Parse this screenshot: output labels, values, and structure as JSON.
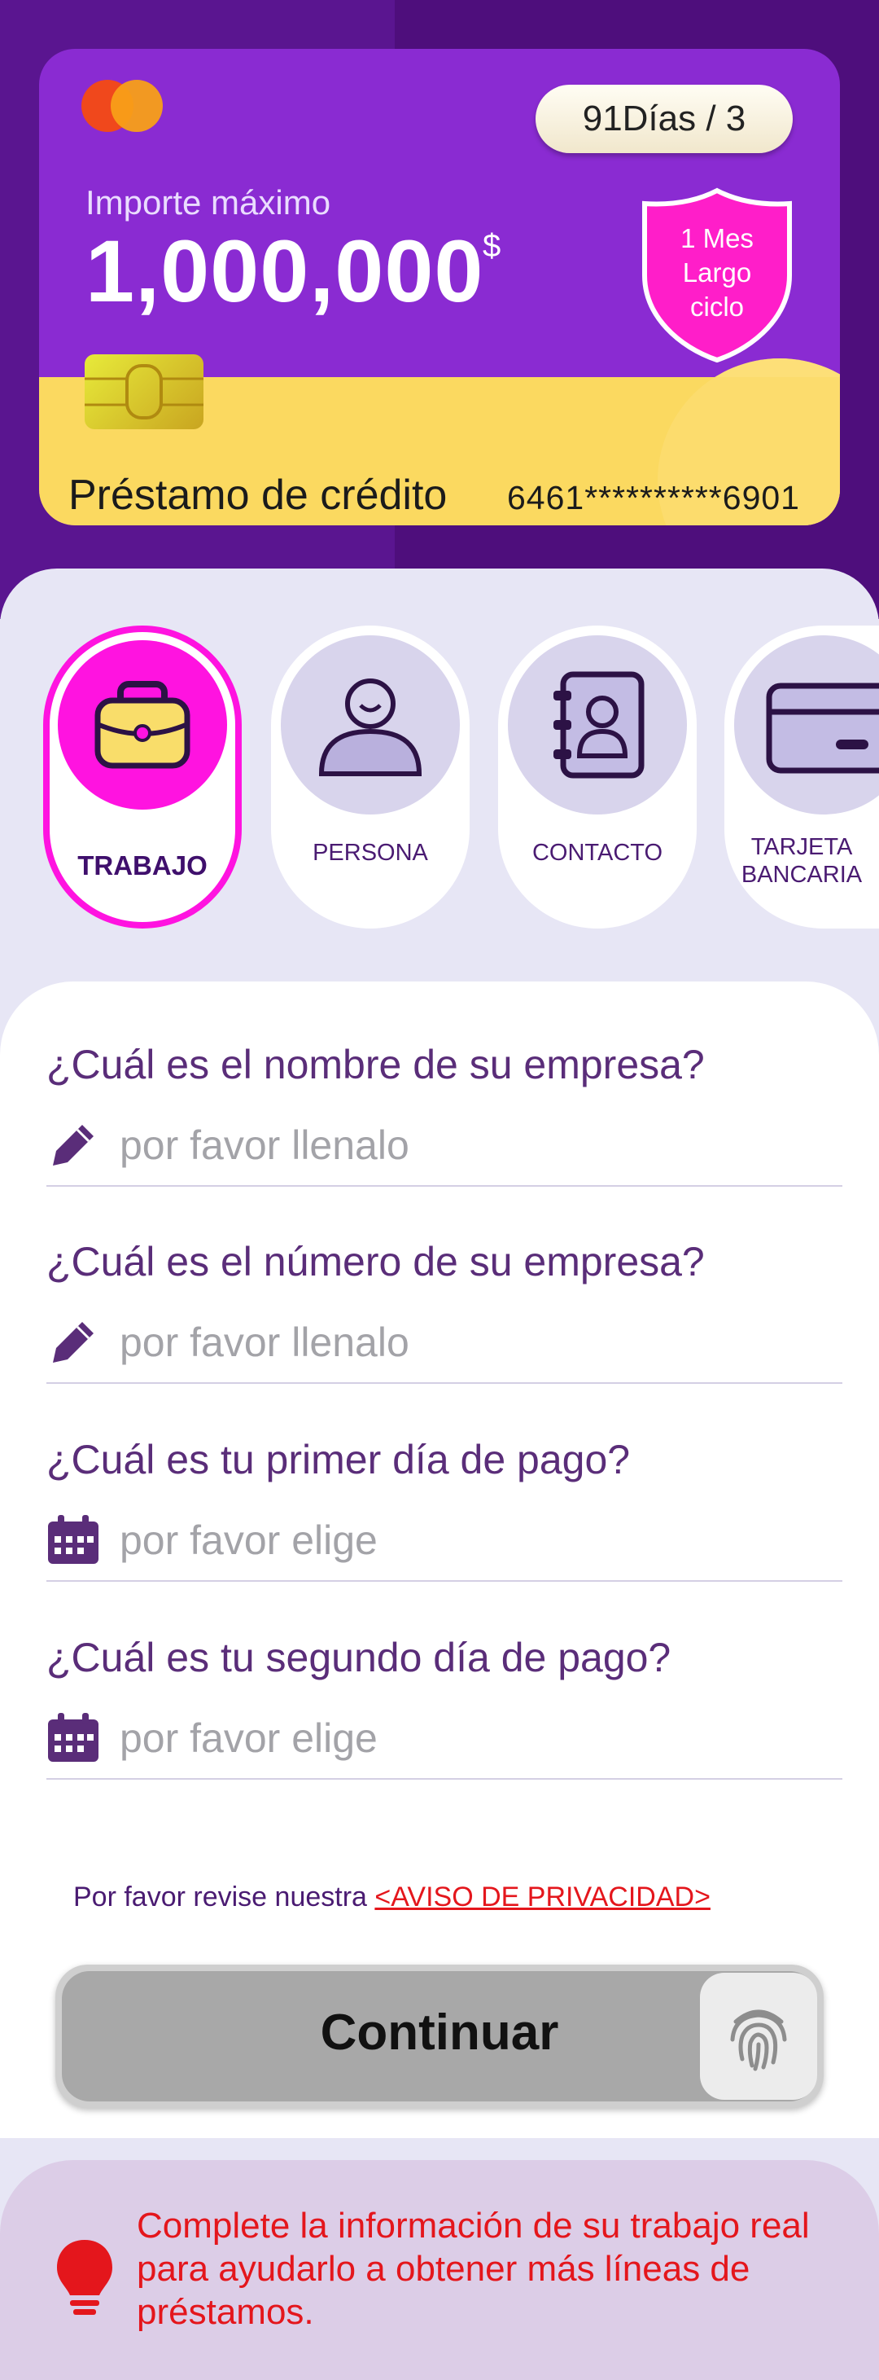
{
  "card": {
    "days_badge": "91Días / 3",
    "amount_label": "Importe máximo",
    "amount": "1,000,000",
    "currency": "$",
    "shield_line1": "1 Mes",
    "shield_line2": "Largo",
    "shield_line3": "ciclo",
    "title": "Préstamo de crédito",
    "number": "6461**********6901"
  },
  "steps": [
    {
      "label": "TRABAJO",
      "icon": "briefcase-icon",
      "active": true
    },
    {
      "label": "PERSONA",
      "icon": "person-icon",
      "active": false
    },
    {
      "label": "CONTACTO",
      "icon": "contact-book-icon",
      "active": false
    },
    {
      "label_line1": "TARJETA",
      "label_line2": "BANCARIA",
      "icon": "bank-card-icon",
      "active": false
    }
  ],
  "form": {
    "questions": [
      {
        "label": "¿Cuál es el nombre de su empresa?",
        "placeholder": "por favor llenalo",
        "icon": "pencil-icon"
      },
      {
        "label": "¿Cuál es el número de su empresa?",
        "placeholder": "por favor llenalo",
        "icon": "pencil-icon"
      },
      {
        "label": "¿Cuál es tu primer día de pago?",
        "placeholder": "por favor elige",
        "icon": "calendar-icon"
      },
      {
        "label": "¿Cuál es tu segundo día de pago?",
        "placeholder": "por favor elige",
        "icon": "calendar-icon"
      }
    ],
    "privacy_text": "Por favor revise nuestra ",
    "privacy_link": "<AVISO DE PRIVACIDAD>",
    "continue_label": "Continuar"
  },
  "tip": {
    "text": "Complete la información de su trabajo real para ayudarlo a obtener más líneas de préstamos.",
    "icon": "lightbulb-icon"
  },
  "colors": {
    "primary": "#8a2bd2",
    "accent": "#ff13e0",
    "warning": "#e4161c",
    "card_yellow": "#fbd960"
  }
}
